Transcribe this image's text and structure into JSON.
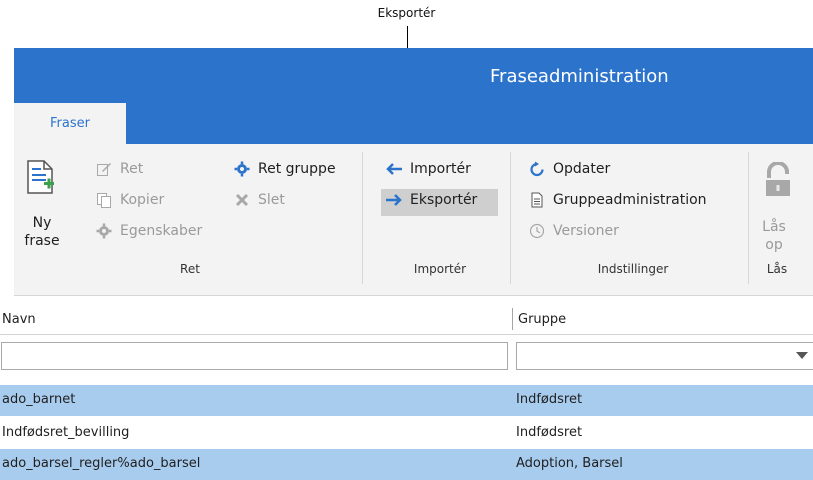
{
  "callout": {
    "label": "Eksportér"
  },
  "app": {
    "title": "Fraseadministration"
  },
  "tabs": [
    {
      "label": "Fraser"
    }
  ],
  "ribbon": {
    "ret_group": {
      "ny_frase": "Ny frase",
      "ret": "Ret",
      "kopier": "Kopier",
      "egenskaber": "Egenskaber",
      "ret_gruppe": "Ret gruppe",
      "slet": "Slet",
      "label": "Ret"
    },
    "import_group": {
      "importer": "Importér",
      "eksporter": "Eksportér",
      "label": "Importér"
    },
    "settings_group": {
      "opdater": "Opdater",
      "gruppeadministration": "Gruppeadministration",
      "versioner": "Versioner",
      "label": "Indstillinger"
    },
    "lock_group": {
      "laas_op": "Lås op",
      "label": "Lås"
    }
  },
  "grid": {
    "columns": [
      "Navn",
      "Gruppe"
    ],
    "filters": {
      "navn": "",
      "gruppe": ""
    },
    "rows": [
      {
        "navn": "ado_barnet",
        "gruppe": "Indfødsret",
        "selected": true
      },
      {
        "navn": "Indfødsret_bevilling",
        "gruppe": "Indfødsret",
        "selected": false
      },
      {
        "navn": "ado_barsel_regler%ado_barsel",
        "gruppe": "Adoption, Barsel",
        "selected": true
      }
    ]
  },
  "colors": {
    "accent": "#2c73cc",
    "selected_row": "#a8ccee",
    "ribbon_bg": "#f3f3f3"
  }
}
